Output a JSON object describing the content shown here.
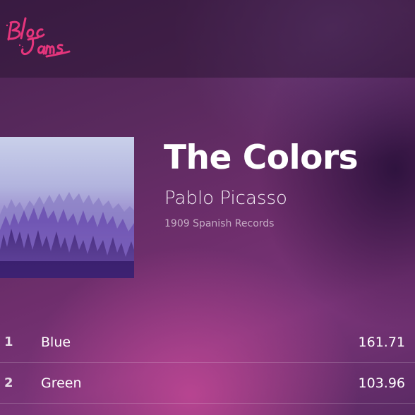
{
  "header": {
    "logo_text": "Bloc Jams"
  },
  "album": {
    "title": "The Colors",
    "artist": "Pablo Picasso",
    "release_info": "1909 Spanish Records",
    "cover_icon": "album-cover-art"
  },
  "songs": [
    {
      "number": "1",
      "title": "Blue",
      "duration": "161.71"
    },
    {
      "number": "2",
      "title": "Green",
      "duration": "103.96"
    }
  ],
  "colors": {
    "logo": "#e5357c",
    "text": "#ffffff"
  }
}
